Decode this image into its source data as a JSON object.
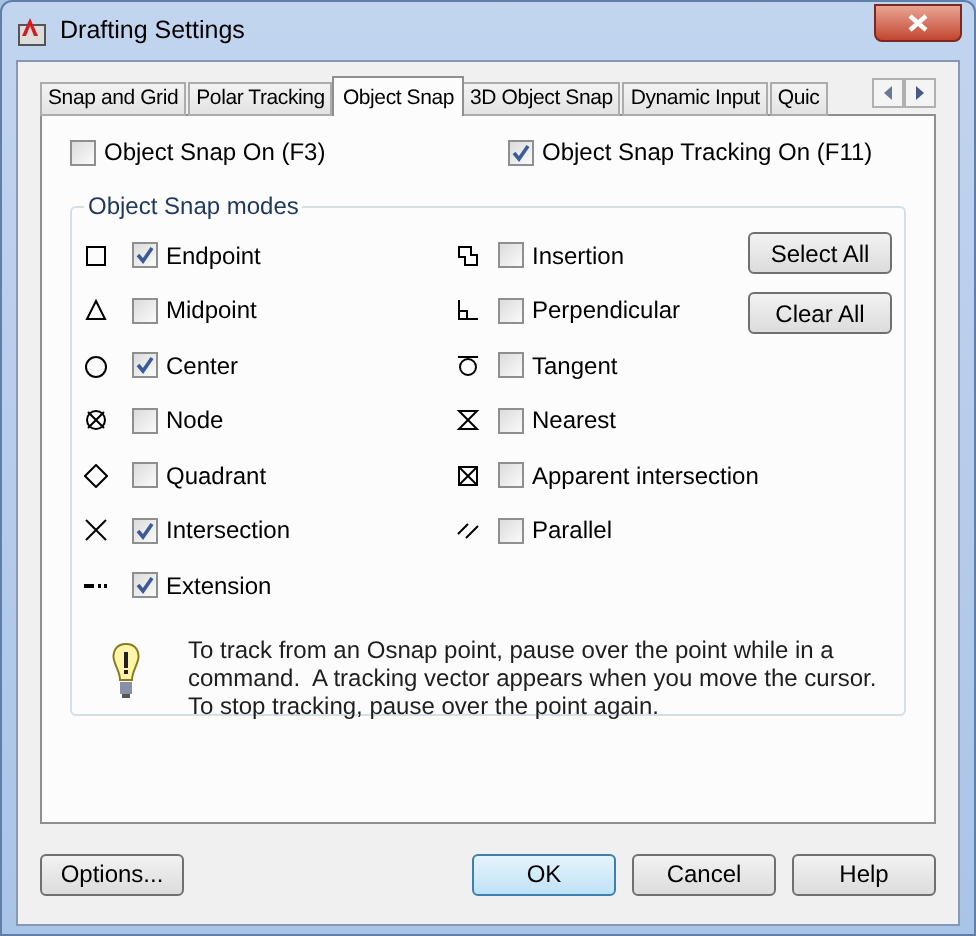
{
  "window": {
    "title": "Drafting Settings"
  },
  "tabs": [
    {
      "label": "Snap and Grid",
      "selected": false
    },
    {
      "label": "Polar Tracking",
      "selected": false
    },
    {
      "label": "Object Snap",
      "selected": true
    },
    {
      "label": "3D Object Snap",
      "selected": false
    },
    {
      "label": "Dynamic Input",
      "selected": false
    },
    {
      "label": "Quic",
      "selected": false
    }
  ],
  "toggles": [
    {
      "label": "Object Snap On (F3)",
      "checked": false
    },
    {
      "label": "Object Snap Tracking On (F11)",
      "checked": true
    }
  ],
  "group": {
    "title": "Object Snap modes",
    "modes_left": [
      {
        "kind": "endpoint",
        "label": "Endpoint",
        "checked": true
      },
      {
        "kind": "midpoint",
        "label": "Midpoint",
        "checked": false
      },
      {
        "kind": "center",
        "label": "Center",
        "checked": true
      },
      {
        "kind": "node",
        "label": "Node",
        "checked": false
      },
      {
        "kind": "quadrant",
        "label": "Quadrant",
        "checked": false
      },
      {
        "kind": "intersection",
        "label": "Intersection",
        "checked": true
      },
      {
        "kind": "extension",
        "label": "Extension",
        "checked": true
      }
    ],
    "modes_right": [
      {
        "kind": "insertion",
        "label": "Insertion",
        "checked": false
      },
      {
        "kind": "perpendicular",
        "label": "Perpendicular",
        "checked": false
      },
      {
        "kind": "tangent",
        "label": "Tangent",
        "checked": false
      },
      {
        "kind": "nearest",
        "label": "Nearest",
        "checked": false
      },
      {
        "kind": "apparent",
        "label": "Apparent intersection",
        "checked": false
      },
      {
        "kind": "parallel",
        "label": "Parallel",
        "checked": false
      }
    ],
    "buttons": [
      "Select All",
      "Clear All"
    ],
    "hint": "To track from an Osnap point, pause over the point while in a\ncommand.  A tracking vector appears when you move the cursor.\nTo stop tracking, pause over the point again."
  },
  "buttons": [
    {
      "label": "Options...",
      "default": false
    },
    {
      "label": "OK",
      "default": true
    },
    {
      "label": "Cancel",
      "default": false
    },
    {
      "label": "Help",
      "default": false
    }
  ]
}
